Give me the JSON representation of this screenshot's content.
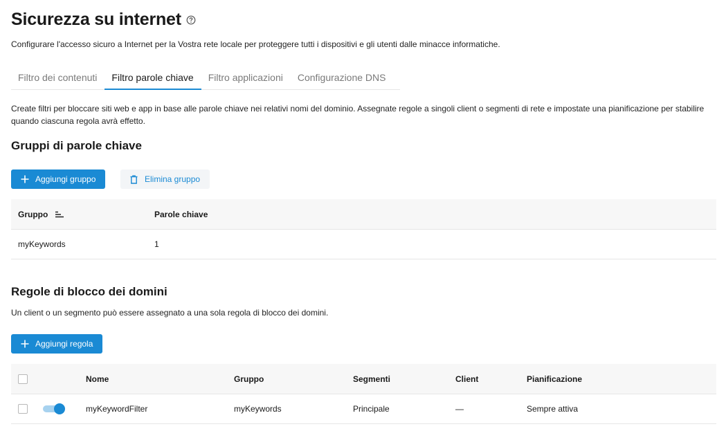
{
  "page": {
    "title": "Sicurezza su internet",
    "subtitle": "Configurare l'accesso sicuro a Internet per la Vostra rete locale per proteggere tutti i dispositivi e gli utenti dalle minacce informatiche."
  },
  "tabs": [
    {
      "label": "Filtro dei contenuti",
      "active": false
    },
    {
      "label": "Filtro parole chiave",
      "active": true
    },
    {
      "label": "Filtro applicazioni",
      "active": false
    },
    {
      "label": "Configurazione DNS",
      "active": false
    }
  ],
  "description": "Create filtri per bloccare siti web e app in base alle parole chiave nei relativi nomi del dominio. Assegnate regole a singoli client o segmenti di rete e impostate una pianificazione per stabilire quando ciascuna regola avrà effetto.",
  "keyword_groups": {
    "heading": "Gruppi di parole chiave",
    "add_button": "Aggiungi gruppo",
    "delete_button": "Elimina gruppo",
    "columns": {
      "group": "Gruppo",
      "keywords": "Parole chiave"
    },
    "rows": [
      {
        "group": "myKeywords",
        "keywords": "1"
      }
    ]
  },
  "domain_rules": {
    "heading": "Regole di blocco dei domini",
    "note": "Un client o un segmento può essere assegnato a una sola regola di blocco dei domini.",
    "add_button": "Aggiungi regola",
    "columns": {
      "name": "Nome",
      "group": "Gruppo",
      "segments": "Segmenti",
      "client": "Client",
      "schedule": "Pianificazione"
    },
    "rows": [
      {
        "enabled": true,
        "name": "myKeywordFilter",
        "group": "myKeywords",
        "segments": "Principale",
        "client": "—",
        "schedule": "Sempre attiva"
      }
    ]
  },
  "colors": {
    "accent": "#1a8ad4",
    "accent_light": "#a7d2ef",
    "header_bg": "#f7f7f7"
  },
  "icons": [
    "help-circle-icon",
    "plus-icon",
    "trash-icon",
    "sort-icon"
  ]
}
